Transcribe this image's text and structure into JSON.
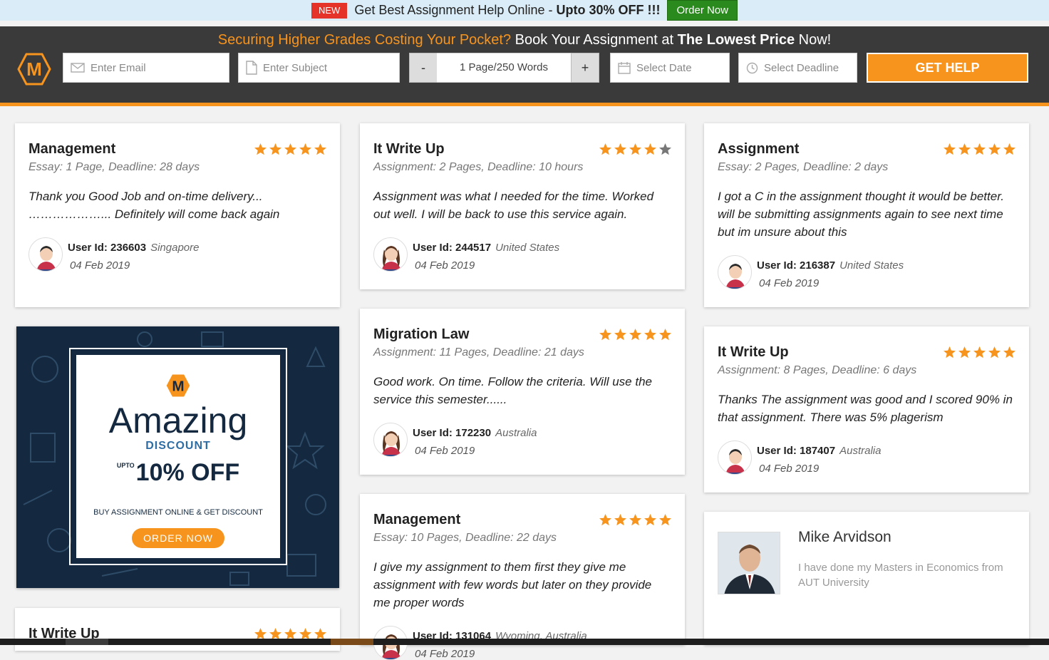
{
  "promo": {
    "badge": "NEW",
    "text_plain": "Get Best Assignment Help Online - ",
    "text_bold": "Upto 30% OFF !!!",
    "order_button": "Order Now"
  },
  "header": {
    "tagline_orange": "Securing Higher Grades Costing Your Pocket?",
    "tagline_mid": " Book Your Assignment at ",
    "tagline_bold": "The Lowest Price",
    "tagline_end": " Now!",
    "email_placeholder": "Enter Email",
    "subject_placeholder": "Enter Subject",
    "minus": "-",
    "pages_value": "1 Page/250 Words",
    "plus": "+",
    "date_placeholder": "Select Date",
    "deadline_placeholder": "Select Deadline",
    "get_help": "GET HELP",
    "logo_letter": "M"
  },
  "reviews": [
    {
      "title": "Management",
      "sub": "Essay: 1 Page, Deadline: 28 days",
      "body": "Thank you Good Job and on-time delivery... ………………... Definitely will come back again",
      "uid_label": "User Id:",
      "uid": "236603",
      "country": "Singapore",
      "date": "04 Feb 2019",
      "rating": 5
    },
    {
      "title": "It Write Up",
      "sub": "Assignment: 2 Pages, Deadline: 10 hours",
      "body": "Assignment was what I needed for the time. Worked out well. I will be back to use this service again.",
      "uid_label": "User Id:",
      "uid": "244517",
      "country": "United States",
      "date": "04 Feb 2019",
      "rating": 4
    },
    {
      "title": "Assignment",
      "sub": "Essay: 2 Pages, Deadline: 2 days",
      "body": "I got a C in the assignment thought it would be better. will be submitting assignments again to see next time but im unsure about this",
      "uid_label": "User Id:",
      "uid": "216387",
      "country": "United States",
      "date": "04 Feb 2019",
      "rating": 5
    },
    {
      "title": "Migration Law",
      "sub": "Assignment: 11 Pages, Deadline: 21 days",
      "body": "Good work. On time. Follow the criteria. Will use the service this semester......",
      "uid_label": "User Id:",
      "uid": "172230",
      "country": "Australia",
      "date": "04 Feb 2019",
      "rating": 5
    },
    {
      "title": "It Write Up",
      "sub": "Assignment: 8 Pages, Deadline: 6 days",
      "body": "Thanks The assignment was good and I scored 90% in that assignment. There was 5% plagerism",
      "uid_label": "User Id:",
      "uid": "187407",
      "country": "Australia",
      "date": "04 Feb 2019",
      "rating": 5
    },
    {
      "title": "Management",
      "sub": "Essay: 10 Pages, Deadline: 22 days",
      "body": "I give my assignment to them first they give me assignment with few words but later on they provide me proper words",
      "uid_label": "User Id:",
      "uid": "131064",
      "country": "Wyoming, Australia",
      "date": "04 Feb 2019",
      "rating": 5
    },
    {
      "title": "It Write Up",
      "rating": 5
    }
  ],
  "ad": {
    "logo_letter": "M",
    "amazing": "Amazing",
    "discount": "DISCOUNT",
    "upto": "UPTO",
    "off": "10% OFF",
    "buy": "BUY ASSIGNMENT ONLINE & GET DISCOUNT",
    "button": "ORDER NOW"
  },
  "profile": {
    "name": "Mike Arvidson",
    "desc": "I have done my Masters in Economics from AUT University"
  },
  "colors": {
    "accent": "#f7941d",
    "header_bg": "#3a3a3a",
    "promo_bg": "#d9ecf7",
    "order_green": "#2a8a1e",
    "star": "#f7941d",
    "star_empty": "#777777"
  }
}
